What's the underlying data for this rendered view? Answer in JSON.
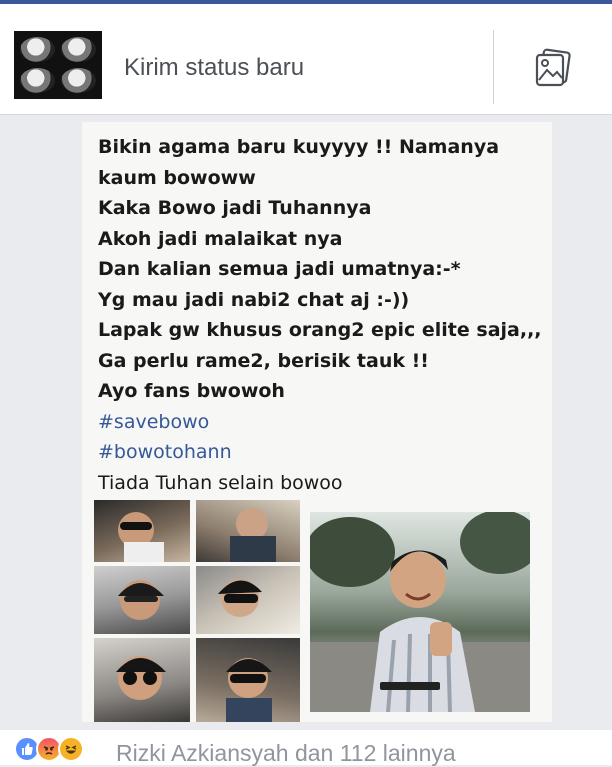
{
  "composer": {
    "placeholder": "Kirim status baru",
    "photo_icon": "photo-icon"
  },
  "post": {
    "lines": [
      "Bikin agama baru kuyyyy !! Namanya",
      "kaum bowoww",
      "Kaka Bowo jadi Tuhannya",
      "Akoh jadi malaikat nya",
      "Dan kalian semua jadi umatnya:-*",
      "Yg mau jadi nabi2 chat aj :-))",
      "Lapak gw khusus orang2 epic elite saja,,,",
      "Ga perlu rame2, berisik tauk !!",
      "Ayo fans bwowoh"
    ],
    "hashtags": [
      "#savebowo",
      "#bowotohann"
    ],
    "closing": "Tiada Tuhan selain bowoo"
  },
  "reactions": {
    "icons": [
      "like-icon",
      "angry-icon",
      "haha-icon"
    ],
    "text": "Rizki Azkiansyah dan 112 lainnya",
    "colors": {
      "like": "#5890ff",
      "angry": "#f25268",
      "haha": "#f7b125"
    }
  }
}
